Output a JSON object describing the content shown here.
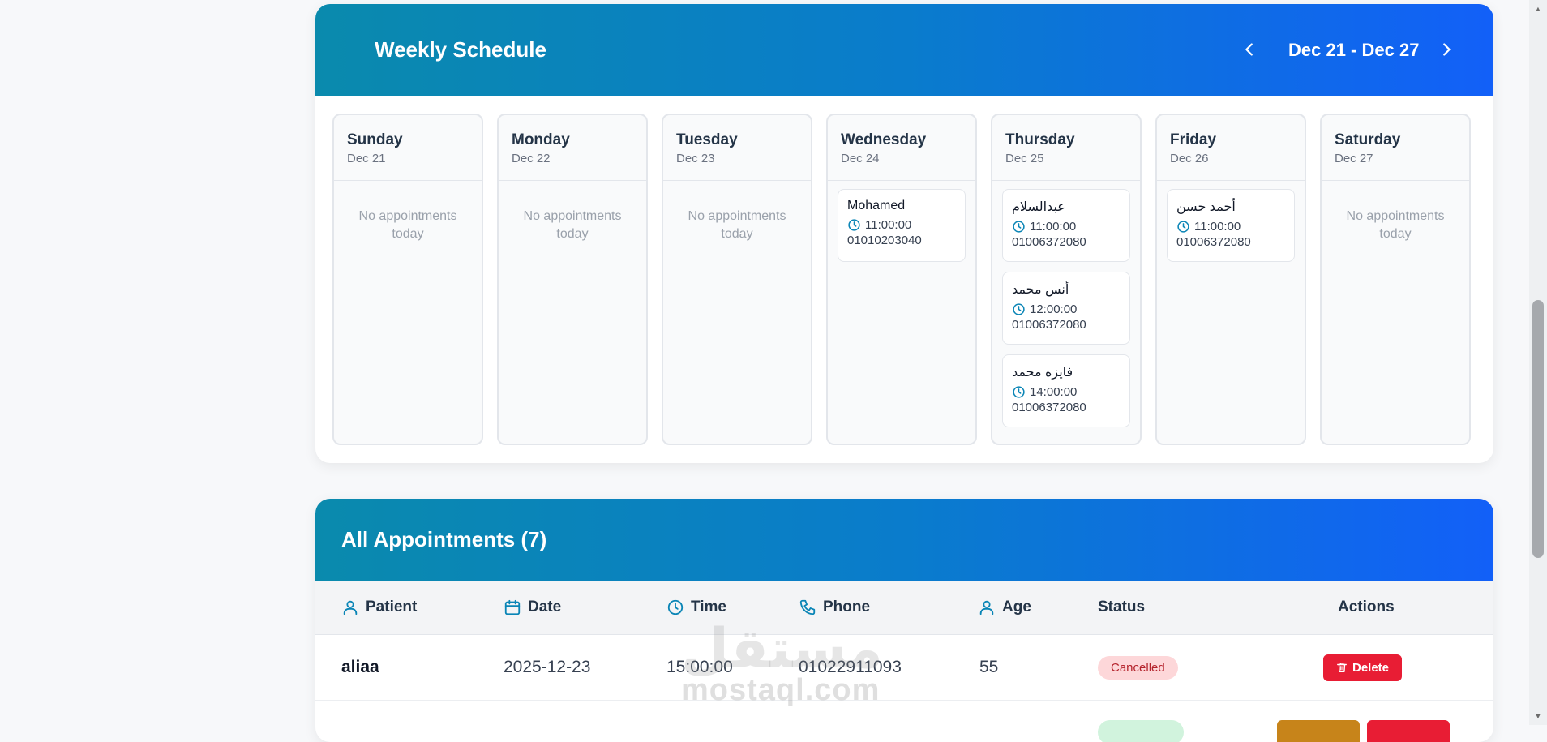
{
  "schedule": {
    "title": "Weekly Schedule",
    "week_range": "Dec 21 - Dec 27",
    "empty_text": "No appointments today",
    "days": [
      {
        "name": "Sunday",
        "date": "Dec 21",
        "appointments": []
      },
      {
        "name": "Monday",
        "date": "Dec 22",
        "appointments": []
      },
      {
        "name": "Tuesday",
        "date": "Dec 23",
        "appointments": []
      },
      {
        "name": "Wednesday",
        "date": "Dec 24",
        "appointments": [
          {
            "name": "Mohamed",
            "time": "11:00:00",
            "phone": "01010203040"
          }
        ]
      },
      {
        "name": "Thursday",
        "date": "Dec 25",
        "appointments": [
          {
            "name": "عبدالسلام",
            "time": "11:00:00",
            "phone": "01006372080"
          },
          {
            "name": "أنس محمد",
            "time": "12:00:00",
            "phone": "01006372080"
          },
          {
            "name": "فايزه محمد",
            "time": "14:00:00",
            "phone": "01006372080"
          }
        ]
      },
      {
        "name": "Friday",
        "date": "Dec 26",
        "appointments": [
          {
            "name": "أحمد حسن",
            "time": "11:00:00",
            "phone": "01006372080"
          }
        ]
      },
      {
        "name": "Saturday",
        "date": "Dec 27",
        "appointments": []
      }
    ]
  },
  "appointments": {
    "title": "All Appointments (7)",
    "columns": {
      "patient": "Patient",
      "date": "Date",
      "time": "Time",
      "phone": "Phone",
      "age": "Age",
      "status": "Status",
      "actions": "Actions"
    },
    "rows": [
      {
        "patient": "aliaa",
        "date": "2025-12-23",
        "time": "15:00:00",
        "phone": "01022911093",
        "age": "55",
        "status": "Cancelled",
        "action": "Delete"
      }
    ]
  },
  "watermark": {
    "arabic": "مستقل",
    "english": "mostaql.com"
  },
  "colors": {
    "header_gradient_start": "#0a8aad",
    "header_gradient_end": "#1260f8",
    "delete": "#e81d34",
    "edit": "#c7841a",
    "cancelled_bg": "#fdd7d9",
    "confirmed_bg": "#d1f3dd"
  }
}
